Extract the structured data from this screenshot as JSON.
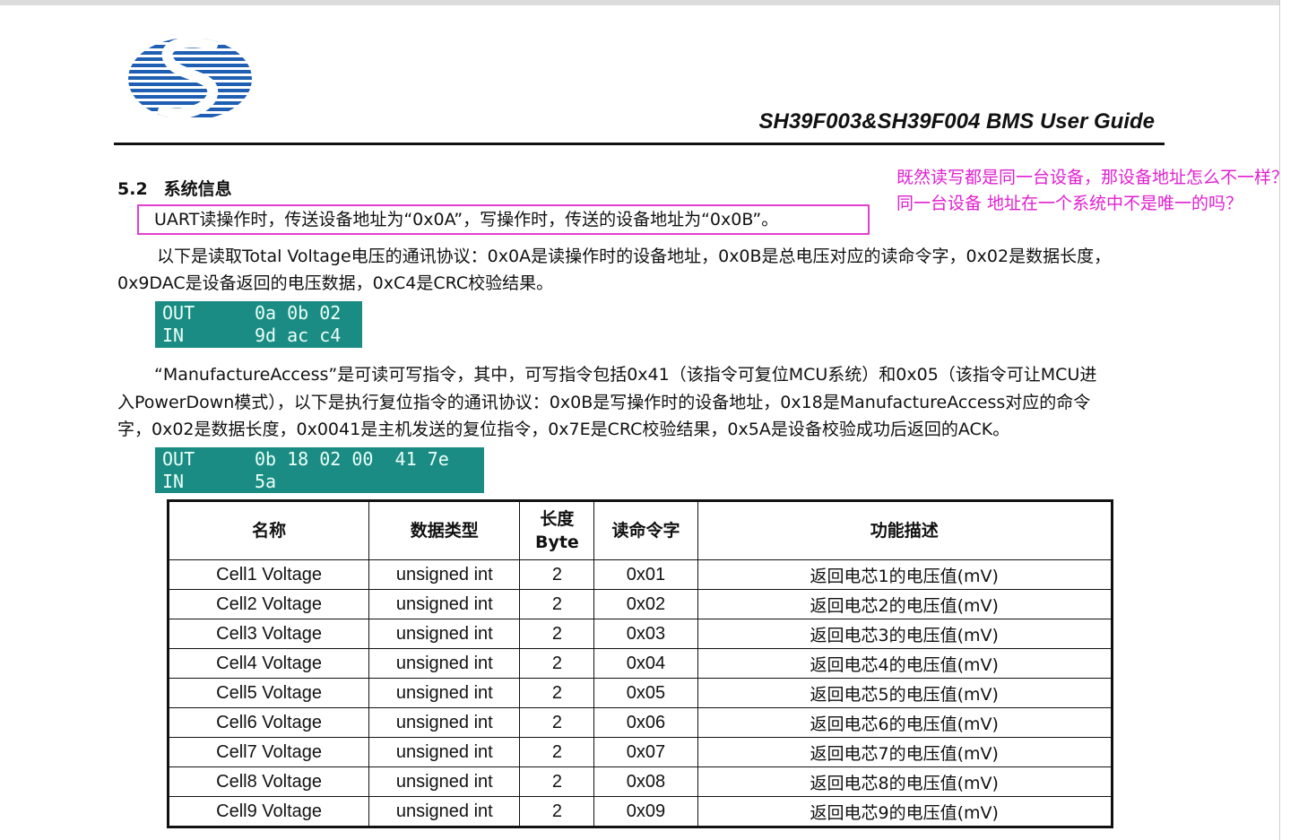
{
  "header": {
    "title": "SH39F003&SH39F004 BMS User Guide",
    "logo_icon": "sinowealth-s-logo"
  },
  "section": {
    "number": "5.2",
    "title": "系统信息"
  },
  "paragraphs": {
    "uart_note": "UART读操作时，传送设备地址为“0x0A”，写操作时，传送的设备地址为“0x0B”。",
    "read_protocol_line1": "以下是读取Total Voltage电压的通讯协议：0x0A是读操作时的设备地址，0x0B是总电压对应的读命令字，0x02是数据长度，",
    "read_protocol_line2": "0x9DAC是设备返回的电压数据，0xC4是CRC校验结果。",
    "mfg_line1": "“ManufactureAccess”是可读可写指令，其中，可写指令包括0x41（该指令可复位MCU系统）和0x05（该指令可让MCU进",
    "mfg_line2": "入PowerDown模式），以下是执行复位指令的通讯协议：0x0B是写操作时的设备地址，0x18是ManufactureAccess对应的命令",
    "mfg_line3": "字，0x02是数据长度，0x0041是主机发送的复位指令，0x7E是CRC校验结果，0x5A是设备校验成功后返回的ACK。"
  },
  "terminal_read": {
    "out_label": "OUT",
    "out_bytes": "0a 0b 02",
    "in_label": "IN",
    "in_bytes": "9d ac c4"
  },
  "terminal_write": {
    "out_label": "OUT",
    "out_bytes": "0b 18 02 00  41 7e",
    "in_label": "IN",
    "in_bytes": "5a"
  },
  "annotation": {
    "text": "既然读写都是同一台设备，那设备地址怎么不一样？同一台设备  地址在一个系统中不是唯一的吗？"
  },
  "table": {
    "headers": {
      "name": "名称",
      "type": "数据类型",
      "length_line1": "长度",
      "length_line2": "Byte",
      "command": "读命令字",
      "description": "功能描述"
    },
    "rows": [
      {
        "name": "Cell1 Voltage",
        "type": "unsigned int",
        "length": "2",
        "command": "0x01",
        "description": "返回电芯1的电压值(mV)"
      },
      {
        "name": "Cell2 Voltage",
        "type": "unsigned int",
        "length": "2",
        "command": "0x02",
        "description": "返回电芯2的电压值(mV)"
      },
      {
        "name": "Cell3 Voltage",
        "type": "unsigned int",
        "length": "2",
        "command": "0x03",
        "description": "返回电芯3的电压值(mV)"
      },
      {
        "name": "Cell4 Voltage",
        "type": "unsigned int",
        "length": "2",
        "command": "0x04",
        "description": "返回电芯4的电压值(mV)"
      },
      {
        "name": "Cell5 Voltage",
        "type": "unsigned int",
        "length": "2",
        "command": "0x05",
        "description": "返回电芯5的电压值(mV)"
      },
      {
        "name": "Cell6 Voltage",
        "type": "unsigned int",
        "length": "2",
        "command": "0x06",
        "description": "返回电芯6的电压值(mV)"
      },
      {
        "name": "Cell7 Voltage",
        "type": "unsigned int",
        "length": "2",
        "command": "0x07",
        "description": "返回电芯7的电压值(mV)"
      },
      {
        "name": "Cell8 Voltage",
        "type": "unsigned int",
        "length": "2",
        "command": "0x08",
        "description": "返回电芯8的电压值(mV)"
      },
      {
        "name": "Cell9 Voltage",
        "type": "unsigned int",
        "length": "2",
        "command": "0x09",
        "description": "返回电芯9的电压值(mV)"
      }
    ]
  },
  "colors": {
    "highlight": "#e040d0",
    "annotation": "#e020d0",
    "terminal_bg": "#1b8c83",
    "logo_blue": "#1f5fb3"
  }
}
